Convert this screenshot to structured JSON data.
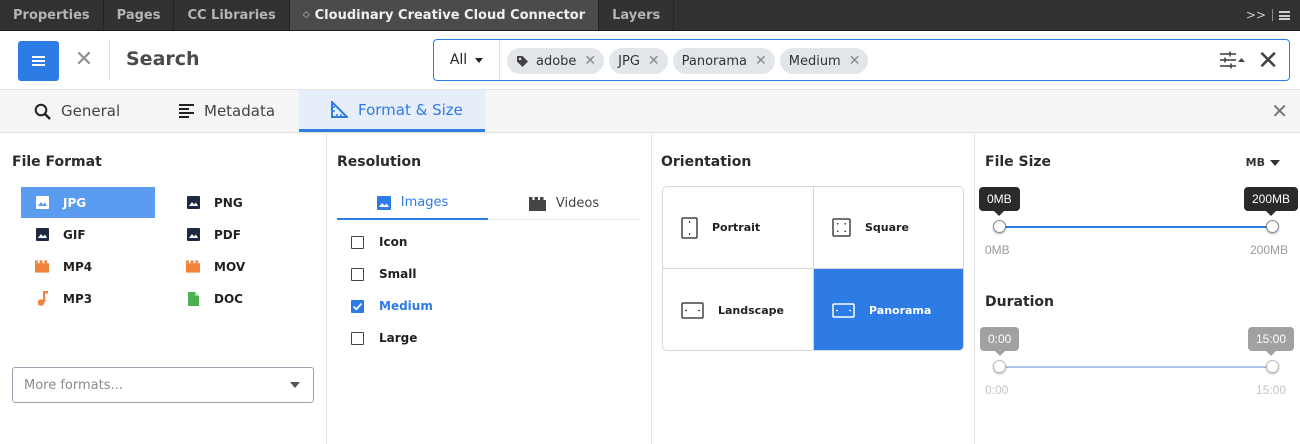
{
  "panel_tabs": [
    {
      "label": "Properties"
    },
    {
      "label": "Pages"
    },
    {
      "label": "CC Libraries"
    },
    {
      "label": "Cloudinary Creative Cloud Connector"
    },
    {
      "label": "Layers"
    }
  ],
  "panel_menu": {
    "overflow": ">>"
  },
  "header": {
    "title": "Search",
    "scope_select": "All",
    "chips": [
      {
        "label": "adobe",
        "icon": "tag-icon"
      },
      {
        "label": "JPG"
      },
      {
        "label": "Panorama"
      },
      {
        "label": "Medium"
      }
    ]
  },
  "filter_tabs": [
    {
      "label": "General",
      "icon": "search-icon"
    },
    {
      "label": "Metadata",
      "icon": "list-icon"
    },
    {
      "label": "Format & Size",
      "icon": "ruler-icon",
      "active": true
    }
  ],
  "file_format": {
    "title": "File Format",
    "items": [
      {
        "label": "JPG",
        "icon": "image-icon",
        "selected": true
      },
      {
        "label": "PNG",
        "icon": "image-icon"
      },
      {
        "label": "GIF",
        "icon": "image-icon"
      },
      {
        "label": "PDF",
        "icon": "image-icon"
      },
      {
        "label": "MP4",
        "icon": "film-icon"
      },
      {
        "label": "MOV",
        "icon": "film-icon"
      },
      {
        "label": "MP3",
        "icon": "music-note-icon"
      },
      {
        "label": "DOC",
        "icon": "document-icon"
      }
    ],
    "more_placeholder": "More formats..."
  },
  "resolution": {
    "title": "Resolution",
    "tabs": [
      {
        "label": "Images",
        "icon": "image-icon",
        "active": true
      },
      {
        "label": "Videos",
        "icon": "film-icon"
      }
    ],
    "options": [
      {
        "label": "Icon",
        "checked": false
      },
      {
        "label": "Small",
        "checked": false
      },
      {
        "label": "Medium",
        "checked": true
      },
      {
        "label": "Large",
        "checked": false
      }
    ]
  },
  "orientation": {
    "title": "Orientation",
    "options": [
      {
        "label": "Portrait",
        "icon": "portrait-icon"
      },
      {
        "label": "Square",
        "icon": "square-icon"
      },
      {
        "label": "Landscape",
        "icon": "landscape-icon"
      },
      {
        "label": "Panorama",
        "icon": "panorama-icon",
        "selected": true
      }
    ]
  },
  "file_size": {
    "title": "File Size",
    "unit": "MB",
    "min_value": "0MB",
    "max_value": "200MB",
    "range_min": "0MB",
    "range_max": "200MB"
  },
  "duration": {
    "title": "Duration",
    "min_value": "0:00",
    "max_value": "15:00",
    "range_min": "0:00",
    "range_max": "15:00"
  },
  "colors": {
    "accent": "#2d7be5",
    "format_selected": "#5a9cf0",
    "video_icon": "#f0823a",
    "doc_icon": "#4caf50",
    "panel_bg": "#323232"
  }
}
